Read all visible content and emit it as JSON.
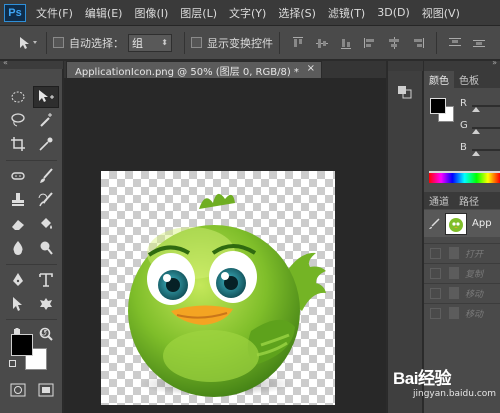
{
  "app": {
    "logo_text": "Ps"
  },
  "menu": {
    "items": [
      "文件(F)",
      "编辑(E)",
      "图像(I)",
      "图层(L)",
      "文字(Y)",
      "选择(S)",
      "滤镜(T)",
      "3D(D)",
      "视图(V)"
    ]
  },
  "options": {
    "auto_select_label": "自动选择：",
    "auto_select_value": "组",
    "show_transform_label": "显示变换控件"
  },
  "document": {
    "tab_title": "ApplicationIcon.png @ 50% (图层 0, RGB/8) *",
    "close_glyph": "×"
  },
  "color_panel": {
    "tabs": [
      "颜色",
      "色板"
    ],
    "channels": [
      "R",
      "G",
      "B"
    ]
  },
  "layers_panel": {
    "tabs": [
      "通道",
      "路径"
    ],
    "layer_name": "App",
    "ghost_rows": [
      "打开",
      "复制",
      "移动",
      "移动"
    ]
  },
  "watermark": {
    "logo": "Bai经验",
    "url": "jingyan.baidu.com"
  },
  "colors": {
    "menubar": "#3a3a3a",
    "toolbar": "#4a4a4a",
    "workspace": "#282828",
    "accent_ps": "#3ea4f3",
    "bird_green": "#7fbe2a"
  },
  "icons": {
    "toolbar": [
      "marquee-icon",
      "move-icon",
      "lasso-icon",
      "magic-wand-icon",
      "crop-icon",
      "eyedropper-icon",
      "healing-icon",
      "brush-icon",
      "clone-stamp-icon",
      "history-brush-icon",
      "eraser-icon",
      "paint-bucket-icon",
      "blur-icon",
      "dodge-icon",
      "pen-icon",
      "type-icon",
      "path-select-icon",
      "shape-icon",
      "hand-icon",
      "zoom-icon",
      "foreground-color-icon",
      "background-color-icon",
      "quick-mask-icon",
      "screen-mode-icon"
    ]
  }
}
